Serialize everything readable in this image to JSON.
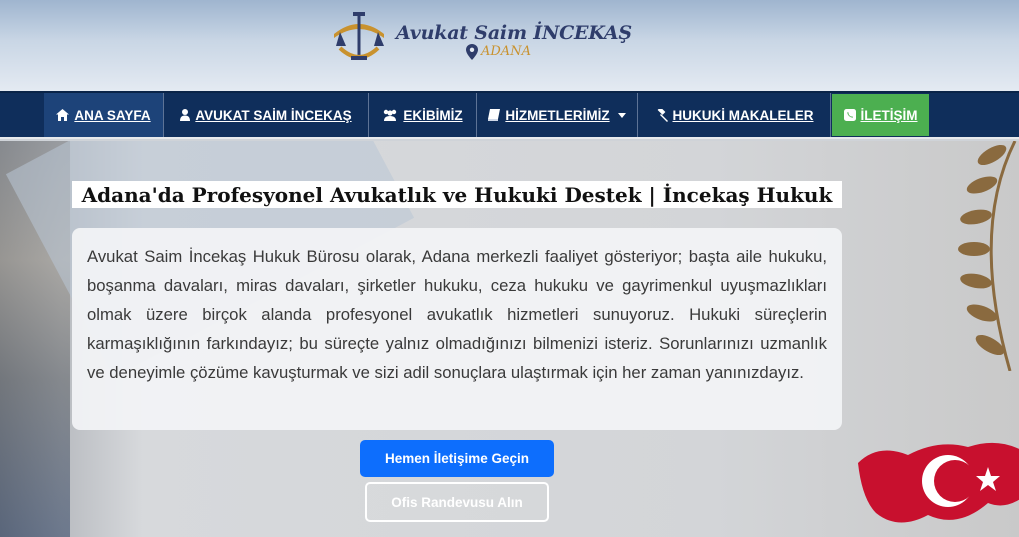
{
  "header": {
    "logo_name": "Avukat Saim İNCEKAŞ",
    "logo_city": "ADANA"
  },
  "nav": {
    "items": [
      {
        "label": "ANA SAYFA",
        "icon": "home-icon"
      },
      {
        "label": "AVUKAT SAİM İNCEKAŞ",
        "icon": "user-icon"
      },
      {
        "label": "EKİBİMİZ",
        "icon": "users-icon"
      },
      {
        "label": "HİZMETLERİMİZ",
        "icon": "book-icon"
      },
      {
        "label": "HUKUKİ MAKALELER",
        "icon": "gavel-icon"
      },
      {
        "label": "İLETİŞİM",
        "icon": "whatsapp-icon"
      }
    ]
  },
  "hero": {
    "title": "Adana'da Profesyonel Avukatlık ve Hukuki Destek | İncekaş Hukuk",
    "body": "Avukat Saim İncekaş Hukuk Bürosu olarak, Adana merkezli faaliyet gösteriyor; başta aile hukuku, boşanma davaları, miras davaları, şirketler hukuku, ceza hukuku ve gayrimenkul uyuşmazlıkları olmak üzere birçok alanda profesyonel avukatlık hizmetleri sunuyoruz. Hukuki süreçlerin karmaşıklığının farkındayız; bu süreçte yalnız olmadığınızı bilmenizi isteriz. Sorunlarınızı uzmanlık ve deneyimle çözüme kavuşturmak ve sizi adil sonuçlara ulaştırmak için her zaman yanınızdayız.",
    "primary_button": "Hemen İletişime Geçin",
    "secondary_button": "Ofis Randevusu Alın"
  },
  "colors": {
    "nav_bg": "#0f2e5b",
    "nav_active": "#1d4379",
    "contact_green": "#4caf50",
    "primary_blue": "#0d6efd"
  }
}
